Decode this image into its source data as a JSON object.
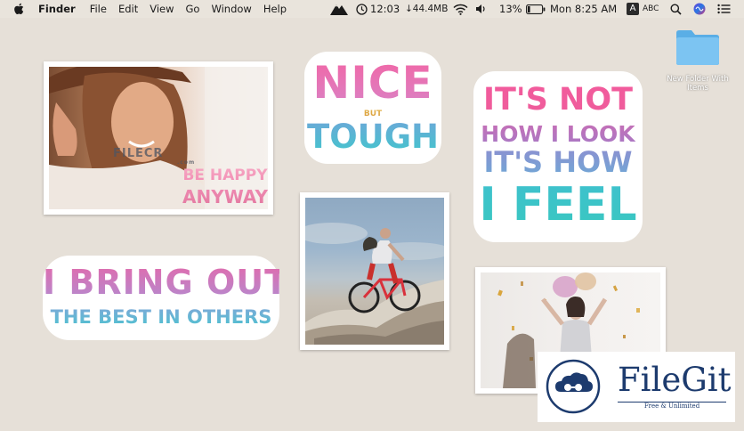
{
  "menubar": {
    "app_name": "Finder",
    "menus": [
      "File",
      "Edit",
      "View",
      "Go",
      "Window",
      "Help"
    ],
    "status": {
      "clock_time": "12:03",
      "network_speed": "↓44.4MB",
      "battery_percent": "13%",
      "datetime": "Mon 8:25 AM",
      "input_badge": "A",
      "input_source": "ABC"
    }
  },
  "desktop": {
    "folder_label": "New Folder With Items"
  },
  "stickers": {
    "be_happy_line1": "BE HAPPY",
    "be_happy_line2": "ANYWAY",
    "nice_top": "NICE",
    "nice_mid": "BUT",
    "nice_bottom": "TOUGH",
    "feel_line1": "IT'S NOT",
    "feel_line2": "HOW I LOOK",
    "feel_line3": "IT'S HOW",
    "feel_line4": "I FEEL",
    "bring_line1": "I BRING OUT",
    "bring_line2": "THE BEST IN OTHERS"
  },
  "watermark": {
    "photo_mark": "FILECR",
    "photo_mark_sub": ".com",
    "brand": "FileGit",
    "tagline": "Free & Unlimited"
  },
  "colors": {
    "sticker_gradient_top": "#f06aa0",
    "sticker_gradient_bottom": "#41c4cc",
    "brand_navy": "#1d3b6e"
  },
  "icons": [
    "apple-icon",
    "mountain-app-icon",
    "clock-icon",
    "wifi-icon",
    "volume-icon",
    "battery-icon",
    "spotlight-icon",
    "siri-icon",
    "list-icon",
    "folder-icon",
    "cloud-logo-icon"
  ]
}
